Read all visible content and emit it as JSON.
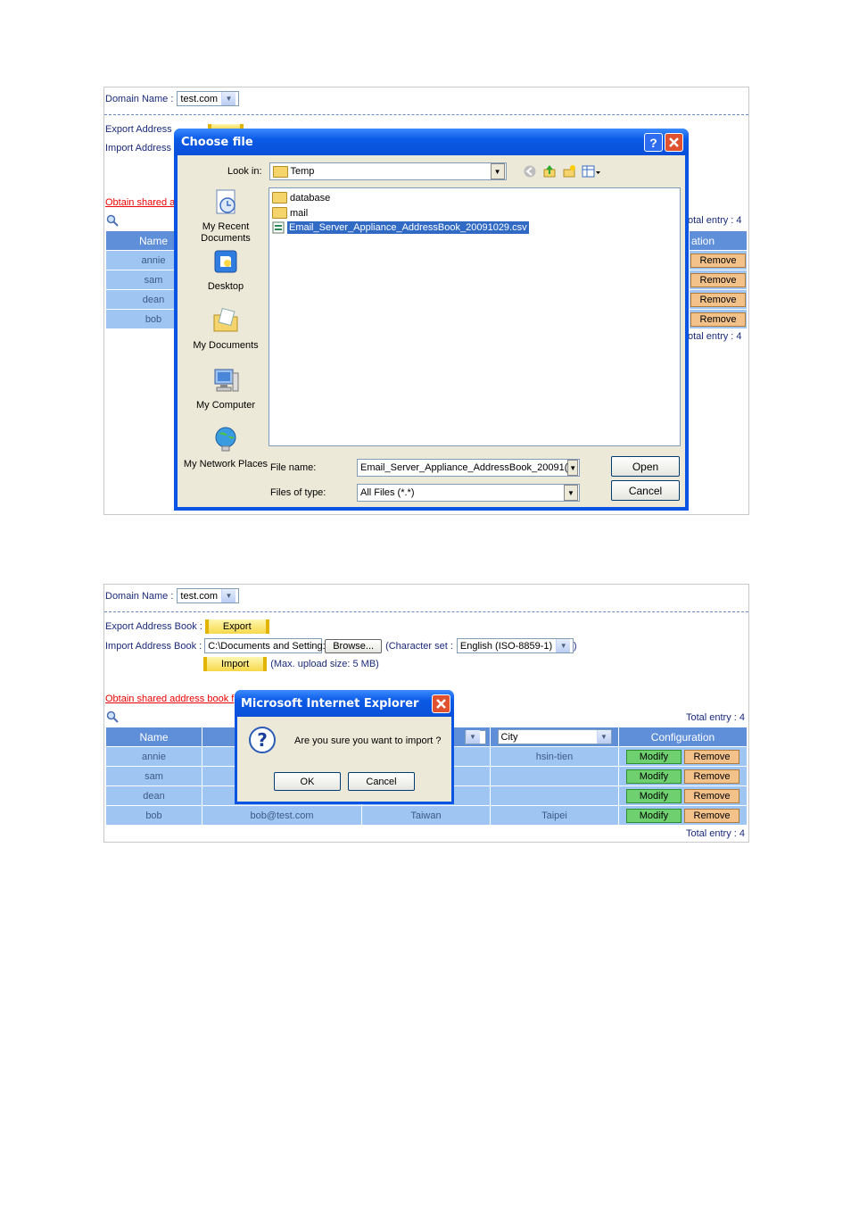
{
  "common": {
    "domain_label": "Domain Name :",
    "domain_value": "test.com",
    "export_label": "Export Address Book :",
    "export_btn": "Export",
    "import_label": "Import Address Book :",
    "obtain_link": "Obtain shared address book f",
    "total_entry": "Total entry : 4",
    "columns": [
      "Name",
      "",
      "",
      "City",
      "Configuration"
    ],
    "modify": "Modify",
    "remove": "Remove"
  },
  "panel1": {
    "export_label_cut": "Export Address",
    "import_label_cut": "Import Address",
    "obtain_link_cut": "Obtain shared a",
    "total_cut_top": "otal entry : 4",
    "total_cut_bottom": "otal entry : 4",
    "header_name": "Name",
    "header_config_cut": "ation",
    "names": [
      "annie",
      "sam",
      "dean",
      "bob"
    ]
  },
  "file_dialog": {
    "title": "Choose file",
    "help": "?",
    "look_in_label": "Look in:",
    "look_in_value": "Temp",
    "places": [
      "My Recent Documents",
      "Desktop",
      "My Documents",
      "My Computer",
      "My Network Places"
    ],
    "items": [
      "database",
      "mail",
      "Email_Server_Appliance_AddressBook_20091029.csv"
    ],
    "file_name_label": "File name:",
    "file_name_value": "Email_Server_Appliance_AddressBook_20091(",
    "file_type_label": "Files of type:",
    "file_type_value": "All Files (*.*)",
    "open": "Open",
    "cancel": "Cancel"
  },
  "panel2": {
    "import_path": "C:\\Documents and Setting:",
    "browse": "Browse...",
    "charset_label": "(Character set :",
    "charset_value": "English (ISO-8859-1)",
    "charset_close": ")",
    "import_btn": "Import",
    "max_upload": "(Max. upload size: 5 MB)",
    "city_select": "City",
    "rows": [
      {
        "name": "annie",
        "email": "",
        "country": "",
        "city": "hsin-tien"
      },
      {
        "name": "sam",
        "email": "",
        "country": "",
        "city": ""
      },
      {
        "name": "dean",
        "email": "",
        "country": "",
        "city": ""
      },
      {
        "name": "bob",
        "email": "bob@test.com",
        "country": "Taiwan",
        "city": "Taipei"
      }
    ]
  },
  "ie_dialog": {
    "title": "Microsoft Internet Explorer",
    "message": "Are you sure you want to import ?",
    "ok": "OK",
    "cancel": "Cancel"
  }
}
